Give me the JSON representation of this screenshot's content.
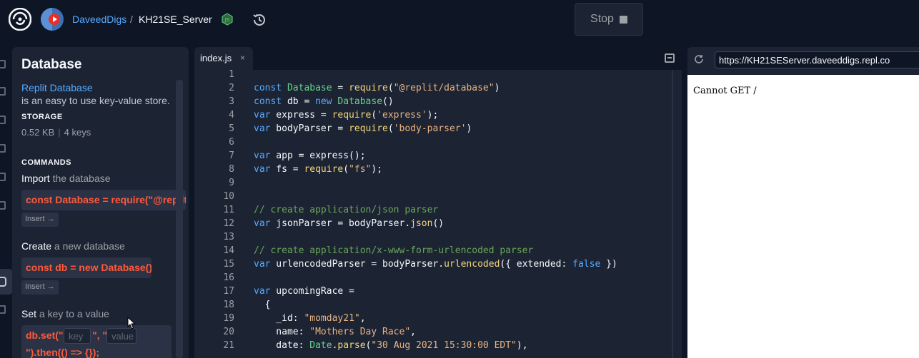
{
  "topbar": {
    "user": "DaveedDigs",
    "separator": "/",
    "repl_name": "KH21SE_Server",
    "stop_label": "Stop"
  },
  "database_panel": {
    "title": "Database",
    "link": "Replit Database",
    "description": "is an easy to use key-value store.",
    "storage_label": "STORAGE",
    "storage_size": "0.52 KB",
    "storage_sep": "|",
    "storage_keys": "4 keys",
    "commands_label": "COMMANDS",
    "commands": [
      {
        "verb": "Import",
        "rest": " the database",
        "code": "const Database = require(\"@replit/database\")",
        "insert": "Insert →"
      },
      {
        "verb": "Create",
        "rest": " a new database",
        "code": "const db = new Database()",
        "insert": "Insert →"
      },
      {
        "verb": "Set",
        "rest": " a key to a value"
      }
    ],
    "set_code": {
      "prefix": "db.set(\"",
      "key_placeholder": "key",
      "middle": "\", \"",
      "value_placeholder": "value",
      "suffix": "\").then(() => {});"
    }
  },
  "editor": {
    "tab_name": "index.js",
    "tab_close": "×",
    "lines": [
      {
        "n": "1",
        "html": ""
      },
      {
        "n": "2",
        "html": "<span class='kw'>const</span> <span class='cls'>Database</span> = <span class='fn'>require</span>(<span class='str'>\"@replit/database\"</span>)"
      },
      {
        "n": "3",
        "html": "<span class='kw'>const</span> db = <span class='kw'>new</span> <span class='cls'>Database</span>()"
      },
      {
        "n": "4",
        "html": "<span class='kw'>var</span> express = <span class='fn'>require</span>(<span class='str'>'express'</span>);"
      },
      {
        "n": "5",
        "html": "<span class='kw'>var</span> bodyParser = <span class='fn'>require</span>(<span class='str'>'body-parser'</span>)"
      },
      {
        "n": "6",
        "html": ""
      },
      {
        "n": "7",
        "html": "<span class='kw'>var</span> app = express();"
      },
      {
        "n": "8",
        "html": "<span class='kw'>var</span> fs = <span class='fn'>require</span>(<span class='str'>\"fs\"</span>);"
      },
      {
        "n": "9",
        "html": ""
      },
      {
        "n": "10",
        "html": ""
      },
      {
        "n": "11",
        "html": "<span class='cm'>// create application/json parser</span>"
      },
      {
        "n": "12",
        "html": "<span class='kw'>var</span> jsonParser = bodyParser.<span class='fn'>json</span>()"
      },
      {
        "n": "13",
        "html": ""
      },
      {
        "n": "14",
        "html": "<span class='cm'>// create application/x-www-form-urlencoded parser</span>"
      },
      {
        "n": "15",
        "html": "<span class='kw'>var</span> urlencodedParser = bodyParser.<span class='fn'>urlencoded</span>({ extended: <span class='kw'>false</span> })"
      },
      {
        "n": "16",
        "html": ""
      },
      {
        "n": "17",
        "html": "<span class='kw'>var</span> upcomingRace ="
      },
      {
        "n": "18",
        "html": "  {"
      },
      {
        "n": "19",
        "html": "    _id: <span class='str'>\"momday21\"</span>,"
      },
      {
        "n": "20",
        "html": "    name: <span class='str'>\"Mothers Day Race\"</span>,"
      },
      {
        "n": "21",
        "html": "    date: <span class='cls'>Date</span>.<span class='fn'>parse</span>(<span class='str'>\"30 Aug 2021 15:30:00 EDT\"</span>),"
      }
    ]
  },
  "webview": {
    "url": "https://KH21SEServer.daveeddigs.repl.co",
    "body_text": "Cannot GET /"
  },
  "colors": {
    "background": "#0e1525",
    "panel": "#1c2333",
    "link": "#57abff",
    "code_chip_text": "#ff5a3c"
  }
}
